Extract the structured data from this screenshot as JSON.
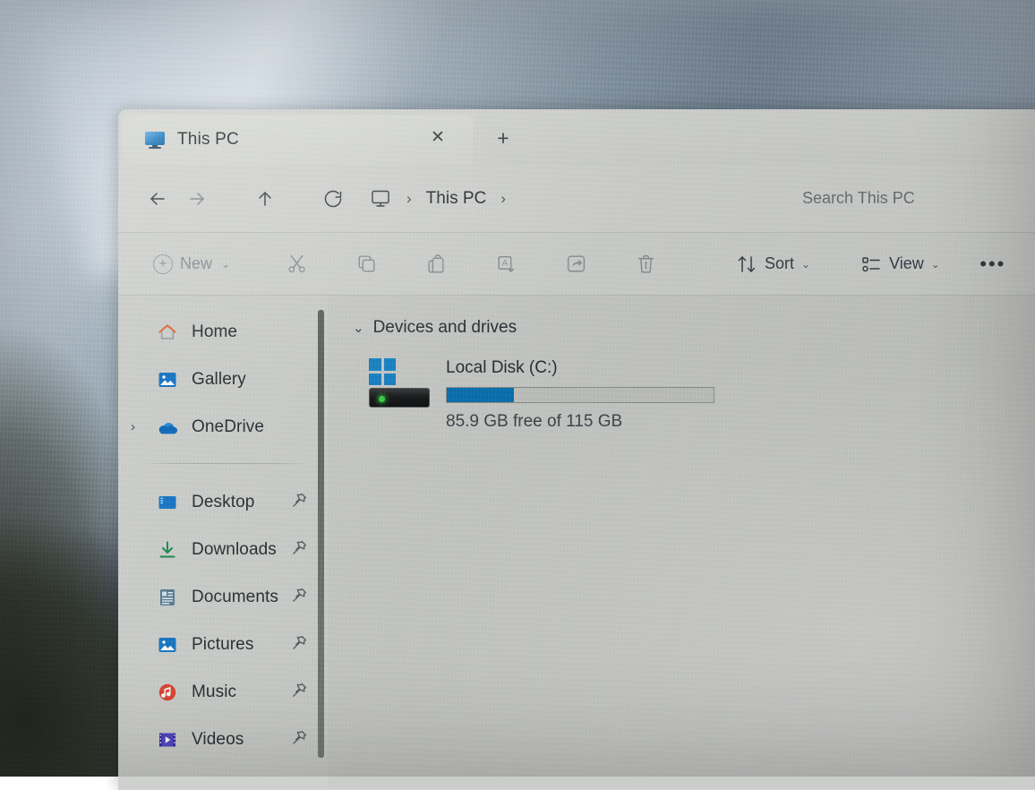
{
  "window": {
    "tab": {
      "title": "This PC",
      "icon": "this-pc-monitor-icon",
      "close_label": "✕",
      "new_tab_label": "+"
    }
  },
  "addressbar": {
    "back_label": "←",
    "forward_label": "→",
    "up_label": "↑",
    "refresh_label": "↻",
    "breadcrumb": {
      "root_icon": "this-pc-monitor-icon",
      "sep1": "›",
      "text": "This PC",
      "sep2": "›"
    },
    "search": {
      "placeholder": "Search This PC",
      "value": ""
    }
  },
  "toolbar": {
    "new_label": "New",
    "new_plus": "+",
    "new_chevron": "⌄",
    "cut_label": "Cut",
    "copy_label": "Copy",
    "paste_label": "Paste",
    "rename_label": "Rename",
    "share_label": "Share",
    "delete_label": "Delete",
    "sort_label": "Sort",
    "sort_chevron": "⌄",
    "view_label": "View",
    "view_chevron": "⌄",
    "more_label": "•••"
  },
  "sidebar": {
    "items": [
      {
        "label": "Home",
        "icon": "home-icon",
        "pinned": false,
        "expandable": false
      },
      {
        "label": "Gallery",
        "icon": "gallery-icon",
        "pinned": false,
        "expandable": false
      },
      {
        "label": "OneDrive",
        "icon": "onedrive-cloud-icon",
        "pinned": false,
        "expandable": true,
        "expander": "›"
      }
    ],
    "pinned_items": [
      {
        "label": "Desktop",
        "icon": "desktop-icon",
        "pinned": true
      },
      {
        "label": "Downloads",
        "icon": "downloads-icon",
        "pinned": true
      },
      {
        "label": "Documents",
        "icon": "documents-icon",
        "pinned": true
      },
      {
        "label": "Pictures",
        "icon": "pictures-icon",
        "pinned": true
      },
      {
        "label": "Music",
        "icon": "music-icon",
        "pinned": true
      },
      {
        "label": "Videos",
        "icon": "videos-icon",
        "pinned": true
      }
    ]
  },
  "content": {
    "group": {
      "chevron": "⌄",
      "title": "Devices and drives"
    },
    "drives": [
      {
        "name": "Local Disk (C:)",
        "icon": "windows-local-disk-icon",
        "free_text": "85.9 GB free of 115 GB",
        "used_percent": 25,
        "bar_fill_color": "#0c74b4"
      }
    ]
  }
}
